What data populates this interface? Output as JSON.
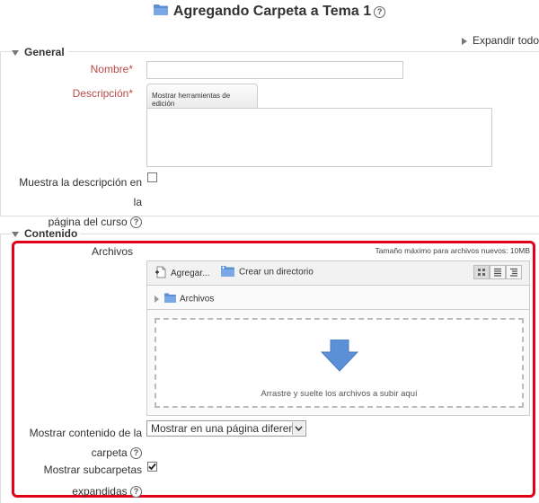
{
  "page": {
    "title": "Agregando Carpeta a Tema 1",
    "help": "?",
    "expand_all": "Expandir todo"
  },
  "general": {
    "legend": "General",
    "name_label": "Nombre",
    "name_value": "",
    "required_mark": "*",
    "description_label": "Descripción",
    "editor_tools_button": "Mostrar herramientas de edición",
    "description_value": "",
    "show_description_line1": "Muestra la descripción en la",
    "show_description_line2": "página del curso",
    "show_description_checked": false
  },
  "content": {
    "legend": "Contenido",
    "files_label": "Archivos",
    "max_size": "Tamaño máximo para archivos nuevos: 10MB",
    "add_label": "Agregar...",
    "create_dir_label": "Crear un directorio",
    "path_label": "Archivos",
    "drop_hint": "Arrastre y suelte los archivos a subir aquí",
    "display_label_line1": "Mostrar contenido de la",
    "display_label_line2": "carpeta",
    "display_option": "Mostrar en una página diferente",
    "subfolders_label_line1": "Mostrar subcarpetas",
    "subfolders_label_line2": "expandidas",
    "subfolders_checked": true
  },
  "colors": {
    "accent_red": "#e2001a",
    "folder_blue": "#5b8fd6",
    "required_red": "#b94a48"
  }
}
